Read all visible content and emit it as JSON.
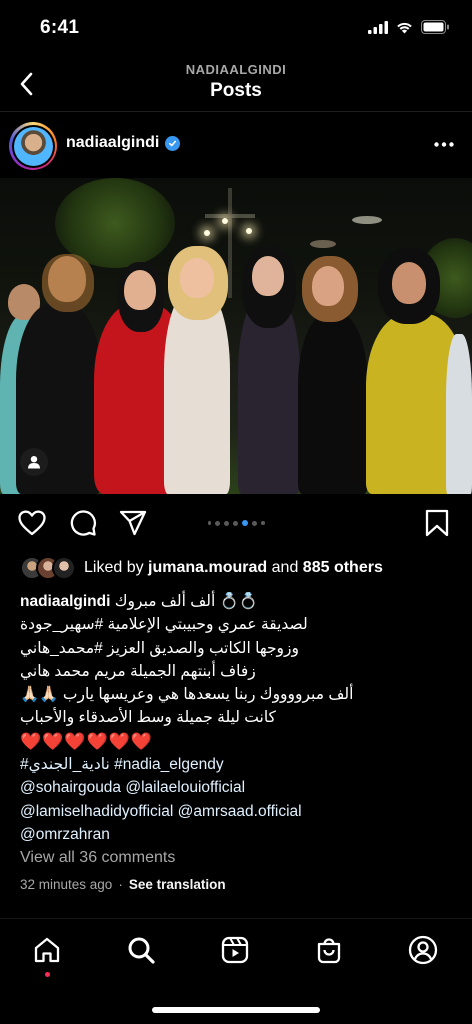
{
  "status_bar": {
    "time": "6:41"
  },
  "header": {
    "subtitle": "NADIAALGINDI",
    "title": "Posts"
  },
  "post": {
    "username": "nadiaalgindi",
    "likes": {
      "prefix": "Liked by",
      "user": "jumana.mourad",
      "connector": "and",
      "others": "885 others"
    },
    "caption": {
      "line1_user": "nadiaalgindi",
      "line1_text": "💍💍 ألف ألف مبروك",
      "line2": "لصديقة عمري وحبيبتي الإعلامية #سهير_جودة",
      "line3": "وزوجها الكاتب والصديق العزيز #محمد_هاني",
      "line4": "زفاف أبنتهم الجميلة مريم محمد هاني",
      "line5": "ألف مبرووووك ربنا يسعدها هي وعريسها يارب 🙏🏻🙏🏻",
      "line6": "كانت ليلة جميلة وسط الأصدقاء والأحباب",
      "line7": "❤️❤️❤️❤️❤️❤️",
      "line8": "#نادية_الجندي #nadia_elgendy",
      "line9": "@sohairgouda @lailaelouiofficial",
      "line10": "@lamiselhadidyofficial @amrsaad.official",
      "line11": "@omrzahran"
    },
    "view_comments": "View all 36 comments",
    "time_ago": "32 minutes ago",
    "separator": "·",
    "see_translation": "See translation",
    "carousel": {
      "total": 7,
      "active_index": 4
    }
  },
  "icons": {
    "back": "chevron-left-icon",
    "more": "more-horizontal-icon",
    "like": "heart-icon",
    "comment": "comment-icon",
    "share": "send-icon",
    "save": "bookmark-icon",
    "tabs": [
      "home-icon",
      "search-icon",
      "reels-icon",
      "shop-icon",
      "profile-icon"
    ]
  },
  "colors": {
    "background": "#000000",
    "verified": "#3897f0",
    "active_dot": "#3897f0",
    "hearts": "#ed4956"
  }
}
